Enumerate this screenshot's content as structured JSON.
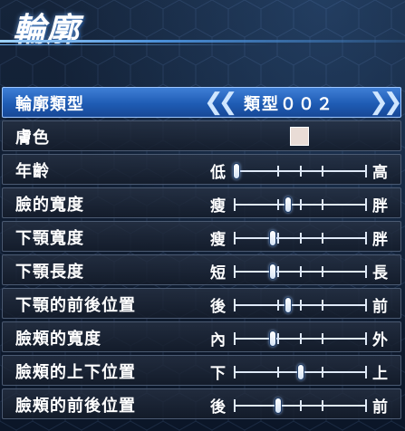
{
  "header": {
    "title": "輪廓"
  },
  "type_row": {
    "label": "輪廓類型",
    "prev_glyph": "❮❮",
    "next_glyph": "❯❯",
    "value": "類型００２"
  },
  "skin_row": {
    "label": "膚色",
    "color": "#e9dcd6"
  },
  "sliders": [
    {
      "label": "年齡",
      "left": "低",
      "right": "高",
      "value": 0.02
    },
    {
      "label": "臉的寬度",
      "left": "瘦",
      "right": "胖",
      "value": 0.41
    },
    {
      "label": "下顎寬度",
      "left": "瘦",
      "right": "胖",
      "value": 0.29
    },
    {
      "label": "下顎長度",
      "left": "短",
      "right": "長",
      "value": 0.29
    },
    {
      "label": "下顎的前後位置",
      "left": "後",
      "right": "前",
      "value": 0.41
    },
    {
      "label": "臉頰的寬度",
      "left": "內",
      "right": "外",
      "value": 0.29
    },
    {
      "label": "臉頰的上下位置",
      "left": "下",
      "right": "上",
      "value": 0.5
    },
    {
      "label": "臉頰的前後位置",
      "left": "後",
      "right": "前",
      "value": 0.33
    }
  ],
  "colors": {
    "selected_row": "#2a68c4",
    "row_border": "#4b5a72",
    "accent_line": "#9fd3ff"
  }
}
